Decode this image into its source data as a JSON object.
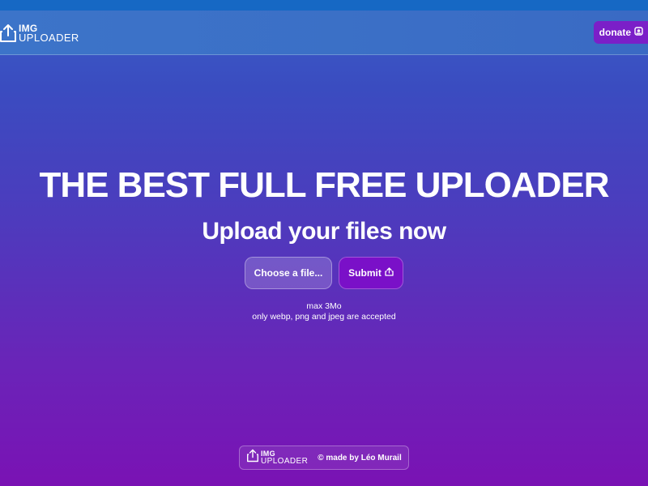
{
  "header": {
    "logo_top": "IMG",
    "logo_bottom": "UPLOADER",
    "donate_label": "donate"
  },
  "hero": {
    "title": "THE BEST FULL FREE UPLOADER",
    "subtitle": "Upload your files now"
  },
  "upload": {
    "choose_label": "Choose a file...",
    "submit_label": "Submit",
    "note_size": "max 3Mo",
    "note_types": "only webp, png and jpeg are accepted"
  },
  "footer": {
    "logo_top": "IMG",
    "logo_bottom": "UPLOADER",
    "credit": "© made by Léo Murail"
  },
  "colors": {
    "accent_purple": "#7a10c8",
    "header_blue": "#3c74c9",
    "top_strip": "#1668c4"
  },
  "icons": {
    "logo": "upload-tray-icon",
    "donate": "coin-icon",
    "submit": "share-icon"
  }
}
